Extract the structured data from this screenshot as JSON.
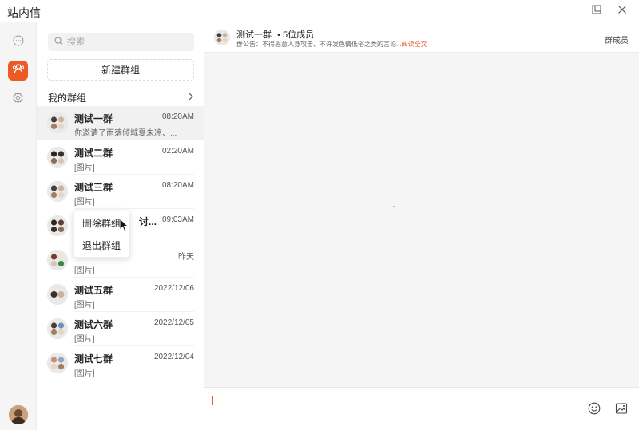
{
  "app": {
    "title": "站内信"
  },
  "rail": {
    "accent": "#ee5a24",
    "icons": [
      "chat-bubble-icon",
      "group-icon",
      "settings-icon"
    ]
  },
  "search": {
    "placeholder": "搜索"
  },
  "new_group": {
    "label": "新建群组"
  },
  "my_groups": {
    "label": "我的群组"
  },
  "groups": [
    {
      "name": "测试一群",
      "time": "08:20AM",
      "last": "你邀请了雨落倾城夏未凉、..."
    },
    {
      "name": "测试二群",
      "time": "02:20AM",
      "last": "[图片]"
    },
    {
      "name": "测试三群",
      "time": "08:20AM",
      "last": "[图片]"
    },
    {
      "name": "讨...",
      "time": "09:03AM",
      "last": ""
    },
    {
      "name": "",
      "time": "昨天",
      "last": "[图片]"
    },
    {
      "name": "测试五群",
      "time": "2022/12/06",
      "last": "[图片]"
    },
    {
      "name": "测试六群",
      "time": "2022/12/05",
      "last": "[图片]"
    },
    {
      "name": "测试七群",
      "time": "2022/12/04",
      "last": "[图片]"
    }
  ],
  "context_menu": {
    "delete": "删除群组",
    "exit": "退出群组"
  },
  "chat": {
    "name": "测试一群",
    "members": "• 5位成员",
    "notice": "群公告：不得恶意人身攻击、不许发色情低俗之类的言论...",
    "read_more": "阅读全文",
    "members_button": "群成员"
  }
}
